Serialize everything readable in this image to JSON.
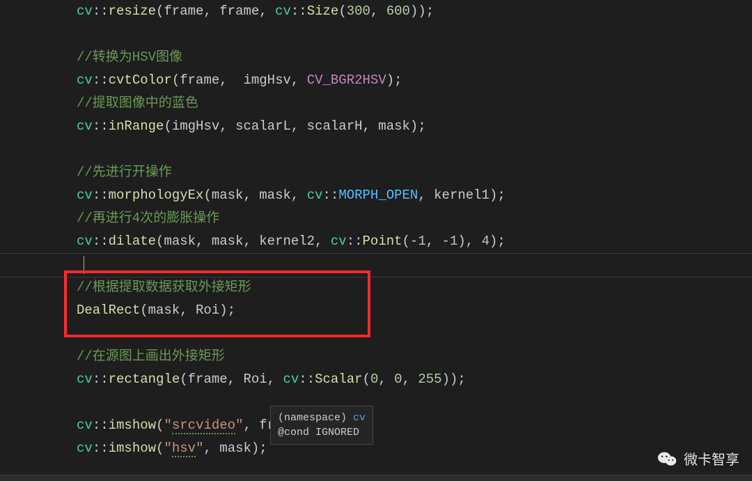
{
  "lines": [
    {
      "type": "code",
      "tokens": [
        {
          "t": "cv",
          "c": "c-ns"
        },
        {
          "t": "::",
          "c": "c-punct"
        },
        {
          "t": "resize",
          "c": "c-func"
        },
        {
          "t": "(frame, frame, ",
          "c": "c-ident"
        },
        {
          "t": "cv",
          "c": "c-ns"
        },
        {
          "t": "::",
          "c": "c-punct"
        },
        {
          "t": "Size",
          "c": "c-func"
        },
        {
          "t": "(",
          "c": "c-punct"
        },
        {
          "t": "300",
          "c": "c-num"
        },
        {
          "t": ", ",
          "c": "c-punct"
        },
        {
          "t": "600",
          "c": "c-num"
        },
        {
          "t": "));",
          "c": "c-punct"
        }
      ]
    },
    {
      "type": "blank"
    },
    {
      "type": "comment",
      "text": "//转换为HSV图像"
    },
    {
      "type": "code",
      "tokens": [
        {
          "t": "cv",
          "c": "c-ns"
        },
        {
          "t": "::",
          "c": "c-punct"
        },
        {
          "t": "cvtColor",
          "c": "c-func"
        },
        {
          "t": "(frame,  imgHsv, ",
          "c": "c-ident"
        },
        {
          "t": "CV_BGR2HSV",
          "c": "c-macro"
        },
        {
          "t": ");",
          "c": "c-punct"
        }
      ]
    },
    {
      "type": "comment",
      "text": "//提取图像中的蓝色"
    },
    {
      "type": "code",
      "tokens": [
        {
          "t": "cv",
          "c": "c-ns"
        },
        {
          "t": "::",
          "c": "c-punct"
        },
        {
          "t": "inRange",
          "c": "c-func"
        },
        {
          "t": "(imgHsv, scalarL, scalarH, mask);",
          "c": "c-ident"
        }
      ]
    },
    {
      "type": "blank"
    },
    {
      "type": "comment",
      "text": "//先进行开操作"
    },
    {
      "type": "code",
      "tokens": [
        {
          "t": "cv",
          "c": "c-ns"
        },
        {
          "t": "::",
          "c": "c-punct"
        },
        {
          "t": "morphologyEx",
          "c": "c-func"
        },
        {
          "t": "(mask, mask, ",
          "c": "c-ident"
        },
        {
          "t": "cv",
          "c": "c-ns"
        },
        {
          "t": "::",
          "c": "c-punct"
        },
        {
          "t": "MORPH_OPEN",
          "c": "c-enum"
        },
        {
          "t": ", kernel1);",
          "c": "c-ident"
        }
      ]
    },
    {
      "type": "comment",
      "text": "//再进行4次的膨胀操作"
    },
    {
      "type": "code",
      "tokens": [
        {
          "t": "cv",
          "c": "c-ns"
        },
        {
          "t": "::",
          "c": "c-punct"
        },
        {
          "t": "dilate",
          "c": "c-func"
        },
        {
          "t": "(mask, mask, kernel2, ",
          "c": "c-ident"
        },
        {
          "t": "cv",
          "c": "c-ns"
        },
        {
          "t": "::",
          "c": "c-punct"
        },
        {
          "t": "Point",
          "c": "c-func"
        },
        {
          "t": "(-",
          "c": "c-punct"
        },
        {
          "t": "1",
          "c": "c-num"
        },
        {
          "t": ", -",
          "c": "c-punct"
        },
        {
          "t": "1",
          "c": "c-num"
        },
        {
          "t": "), ",
          "c": "c-punct"
        },
        {
          "t": "4",
          "c": "c-num"
        },
        {
          "t": ");",
          "c": "c-punct"
        }
      ]
    },
    {
      "type": "blank",
      "cursor": true
    },
    {
      "type": "comment",
      "text": "//根据提取数据获取外接矩形"
    },
    {
      "type": "code",
      "tokens": [
        {
          "t": "DealRect",
          "c": "c-func"
        },
        {
          "t": "(mask, Roi);",
          "c": "c-ident"
        }
      ]
    },
    {
      "type": "blank"
    },
    {
      "type": "comment",
      "text": "//在源图上画出外接矩形"
    },
    {
      "type": "code",
      "tokens": [
        {
          "t": "cv",
          "c": "c-ns"
        },
        {
          "t": "::",
          "c": "c-punct"
        },
        {
          "t": "rectangle",
          "c": "c-func"
        },
        {
          "t": "(frame, Roi, ",
          "c": "c-ident"
        },
        {
          "t": "cv",
          "c": "c-ns"
        },
        {
          "t": "::",
          "c": "c-punct"
        },
        {
          "t": "Scalar",
          "c": "c-func"
        },
        {
          "t": "(",
          "c": "c-punct"
        },
        {
          "t": "0",
          "c": "c-num"
        },
        {
          "t": ", ",
          "c": "c-punct"
        },
        {
          "t": "0",
          "c": "c-num"
        },
        {
          "t": ", ",
          "c": "c-punct"
        },
        {
          "t": "255",
          "c": "c-num"
        },
        {
          "t": "));",
          "c": "c-punct"
        }
      ]
    },
    {
      "type": "blank"
    },
    {
      "type": "code",
      "tokens": [
        {
          "t": "cv",
          "c": "c-ns"
        },
        {
          "t": "::",
          "c": "c-punct"
        },
        {
          "t": "imshow",
          "c": "c-func"
        },
        {
          "t": "(",
          "c": "c-punct"
        },
        {
          "t": "\"",
          "c": "c-str"
        },
        {
          "t": "srcvideo",
          "c": "c-str c-squiggle"
        },
        {
          "t": "\"",
          "c": "c-str"
        },
        {
          "t": ", frame);",
          "c": "c-ident"
        }
      ]
    },
    {
      "type": "code",
      "tokens": [
        {
          "t": "cv",
          "c": "c-ns"
        },
        {
          "t": "::",
          "c": "c-punct"
        },
        {
          "t": "imshow",
          "c": "c-func"
        },
        {
          "t": "(",
          "c": "c-punct"
        },
        {
          "t": "\"",
          "c": "c-str"
        },
        {
          "t": "hsv",
          "c": "c-str c-squiggle"
        },
        {
          "t": "\"",
          "c": "c-str"
        },
        {
          "t": ", mask);",
          "c": "c-ident"
        }
      ]
    }
  ],
  "tooltip": {
    "line1_prefix": "(namespace) ",
    "line1_sym": "cv",
    "line2": "@cond IGNORED"
  },
  "watermark": "微卡智享"
}
